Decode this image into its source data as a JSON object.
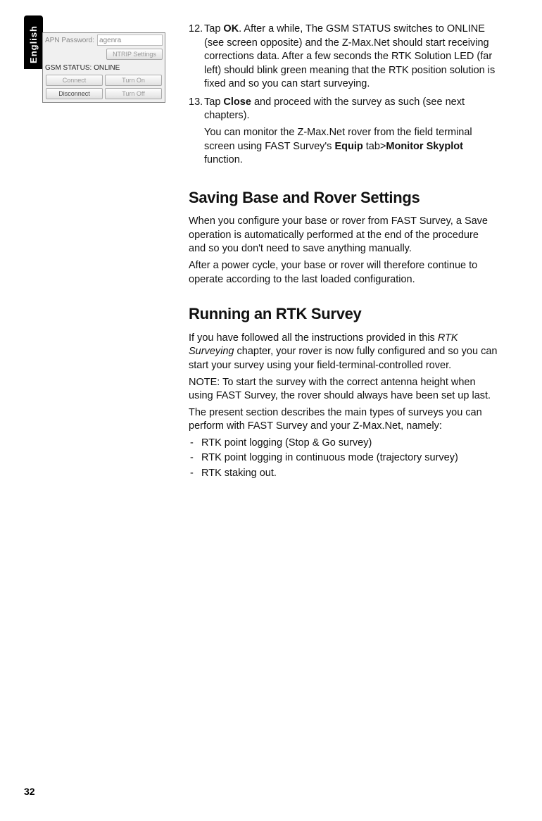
{
  "language_tab": "English",
  "screenshot": {
    "apn_label": "APN Password:",
    "apn_value": "agenra",
    "ntrip_button": "NTRIP Settings",
    "status_line": "GSM STATUS: ONLINE",
    "btn_connect": "Connect",
    "btn_turnon": "Turn On",
    "btn_disconnect": "Disconnect",
    "btn_turnoff": "Turn Off"
  },
  "steps": {
    "s12_num": "12.",
    "s12_a": "Tap ",
    "s12_ok": "OK",
    "s12_b": ". After a while, The GSM STATUS switches to ONLINE (see screen opposite) and the Z-Max.Net should start receiving corrections data. After a few seconds the RTK Solution LED (far left) should blink green meaning that the RTK position solution is fixed and so you can start surveying.",
    "s13_num": "13.",
    "s13_a": "Tap ",
    "s13_close": "Close",
    "s13_b": " and proceed with the survey as such (see next chapters).",
    "s13_c1": "You can monitor the Z-Max.Net rover from the field terminal screen using FAST Survey's ",
    "s13_equip": "Equip",
    "s13_c2": " tab>",
    "s13_monitor": "Monitor Skyplot",
    "s13_c3": " function."
  },
  "h1": "Saving Base and Rover Settings",
  "p1": "When you configure your base or rover from FAST Survey, a Save operation is automatically performed at the end of the procedure and so you don't need to save anything manually.",
  "p2": "After a power cycle, your base or rover will therefore continue to operate according to the last loaded configuration.",
  "h2": "Running an RTK Survey",
  "p3a": "If you have followed all the instructions provided in this ",
  "p3b": "RTK Surveying",
  "p3c": " chapter, your rover is now fully configured and so you can start your survey using your field-terminal-controlled rover.",
  "p4": "NOTE: To start the survey with the correct antenna height when using FAST Survey, the rover should always have been set up last.",
  "p5": "The present section describes the main types of surveys you can perform with FAST Survey and your Z-Max.Net, namely:",
  "bullets": {
    "b1": "RTK point logging (Stop & Go survey)",
    "b2": "RTK point logging in continuous mode (trajectory survey)",
    "b3": "RTK staking out."
  },
  "page_number": "32"
}
